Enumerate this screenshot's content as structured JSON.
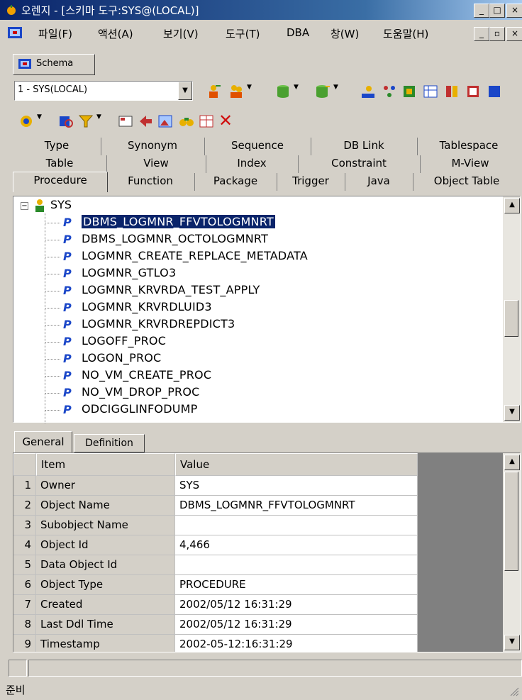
{
  "window": {
    "title": "오렌지 - [스키마 도구:SYS@(LOCAL)]",
    "min_label": "_",
    "max_label": "□",
    "close_label": "×"
  },
  "menu": {
    "items": [
      "파일(F)",
      "액션(A)",
      "보기(V)",
      "도구(T)",
      "DBA",
      "창(W)",
      "도움말(H)"
    ]
  },
  "schema_tab": {
    "label": "Schema"
  },
  "toolbar": {
    "connection": "1 - SYS(LOCAL)"
  },
  "object_tabs": {
    "row1": [
      "Type",
      "Synonym",
      "Sequence",
      "DB Link",
      "Tablespace"
    ],
    "row2": [
      "Table",
      "View",
      "Index",
      "Constraint",
      "M-View"
    ],
    "row3": [
      "Procedure",
      "Function",
      "Package",
      "Trigger",
      "Java",
      "Object Table"
    ]
  },
  "tree": {
    "root": "SYS",
    "items": [
      "DBMS_LOGMNR_FFVTOLOGMNRT",
      "DBMS_LOGMNR_OCTOLOGMNRT",
      "LOGMNR_CREATE_REPLACE_METADATA",
      "LOGMNR_GTLO3",
      "LOGMNR_KRVRDA_TEST_APPLY",
      "LOGMNR_KRVRDLUID3",
      "LOGMNR_KRVRDREPDICT3",
      "LOGOFF_PROC",
      "LOGON_PROC",
      "NO_VM_CREATE_PROC",
      "NO_VM_DROP_PROC",
      "ODCIGGLINFODUMP"
    ],
    "selected_index": 0
  },
  "detail_tabs": [
    "General",
    "Definition"
  ],
  "grid": {
    "headers": [
      "Item",
      "Value"
    ],
    "rows": [
      {
        "num": "1",
        "item": "Owner",
        "value": "SYS"
      },
      {
        "num": "2",
        "item": "Object Name",
        "value": "DBMS_LOGMNR_FFVTOLOGMNRT"
      },
      {
        "num": "3",
        "item": "Subobject Name",
        "value": ""
      },
      {
        "num": "4",
        "item": "Object Id",
        "value": "4,466"
      },
      {
        "num": "5",
        "item": "Data Object Id",
        "value": ""
      },
      {
        "num": "6",
        "item": "Object Type",
        "value": "PROCEDURE"
      },
      {
        "num": "7",
        "item": "Created",
        "value": "2002/05/12 16:31:29"
      },
      {
        "num": "8",
        "item": "Last Ddl Time",
        "value": "2002/05/12 16:31:29"
      },
      {
        "num": "9",
        "item": "Timestamp",
        "value": "2002-05-12:16:31:29"
      }
    ]
  },
  "status": {
    "text": "준비"
  },
  "colors": {
    "selection": "#0a246a",
    "title_start": "#0a246a",
    "procedure_icon": "#1a46c8"
  }
}
